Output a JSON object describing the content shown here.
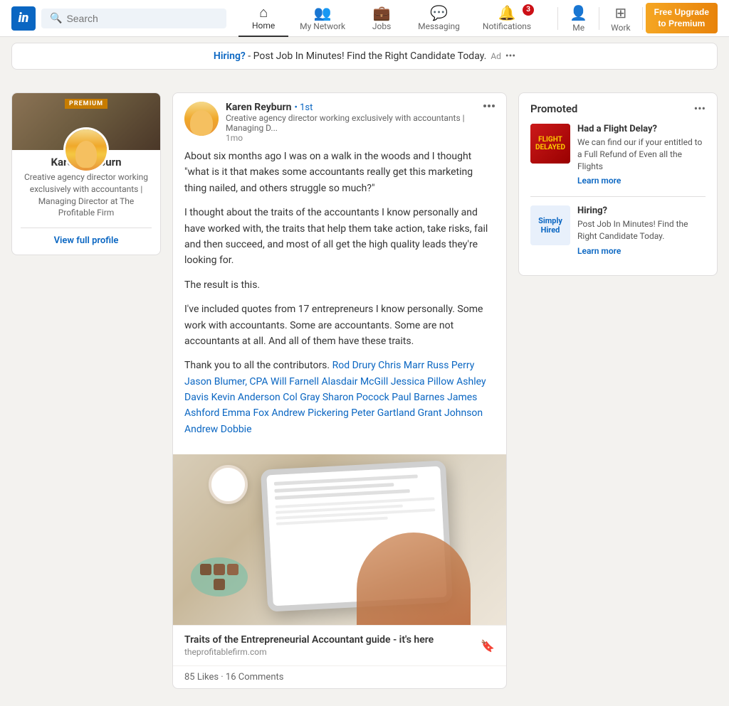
{
  "navbar": {
    "logo_text": "in",
    "search_placeholder": "Search",
    "nav_items": [
      {
        "id": "home",
        "label": "Home",
        "icon": "⌂",
        "active": true
      },
      {
        "id": "network",
        "label": "My Network",
        "icon": "👥"
      },
      {
        "id": "jobs",
        "label": "Jobs",
        "icon": "💼"
      },
      {
        "id": "messaging",
        "label": "Messaging",
        "icon": "💬"
      },
      {
        "id": "notifications",
        "label": "Notifications",
        "icon": "🔔",
        "badge": "3"
      }
    ],
    "me_label": "Me",
    "work_label": "Work",
    "premium_line1": "Free Upgrade",
    "premium_line2": "to Premium"
  },
  "top_banner": {
    "text_highlight": "Hiring?",
    "text_rest": " - Post Job In Minutes! Find the Right Candidate Today.",
    "ad_label": "Ad"
  },
  "sidebar": {
    "premium_badge": "PREMIUM",
    "name": "Karen Reyburn",
    "description": "Creative agency director working exclusively with accountants | Managing Director at The Profitable Firm",
    "view_profile_label": "View full profile"
  },
  "post": {
    "author_name": "Karen Reyburn",
    "connection": "• 1st",
    "author_desc": "Creative agency director working exclusively with accountants | Managing D...",
    "time": "1mo",
    "body_p1": "About six months ago I was on a walk in the woods and I thought \"what is it that makes some accountants really get this marketing thing nailed, and others struggle so much?\"",
    "body_p2": "I thought about the traits of the accountants I know personally and have worked with, the traits that help them take action, take risks, fail and then succeed, and most of all get the high quality leads they're looking for.",
    "body_p3": "The result is this.",
    "body_p4": "I've included quotes from 17 entrepreneurs I know personally. Some work with accountants. Some are accountants. Some are not accountants at all. And all of them have these traits.",
    "body_p5": "Thank you to all the contributors.",
    "contributors": "Rod Drury  Chris Marr  Russ Perry  Jason Blumer, CPA  Will Farnell  Alasdair McGill  Jessica Pillow  Ashley Davis  Kevin Anderson  Col Gray  Sharon Pocock  Paul Barnes  James Ashford  Emma Fox  Andrew Pickering  Peter Gartland  Grant Johnson  Andrew Dobbie",
    "link_title": "Traits of the Entrepreneurial Accountant guide - it's here",
    "link_domain": "theprofitablefirm.com",
    "stats": "85 Likes · 16 Comments"
  },
  "promoted": {
    "title": "Promoted",
    "item1": {
      "name": "Had a Flight Delay?",
      "desc": "We can find our if your entitled to a Full Refund of Even all the Flights",
      "link": "Learn more"
    },
    "item2": {
      "name": "Hiring?",
      "desc": "Post Job In Minutes! Find the Right Candidate Today.",
      "link": "Learn more"
    }
  }
}
